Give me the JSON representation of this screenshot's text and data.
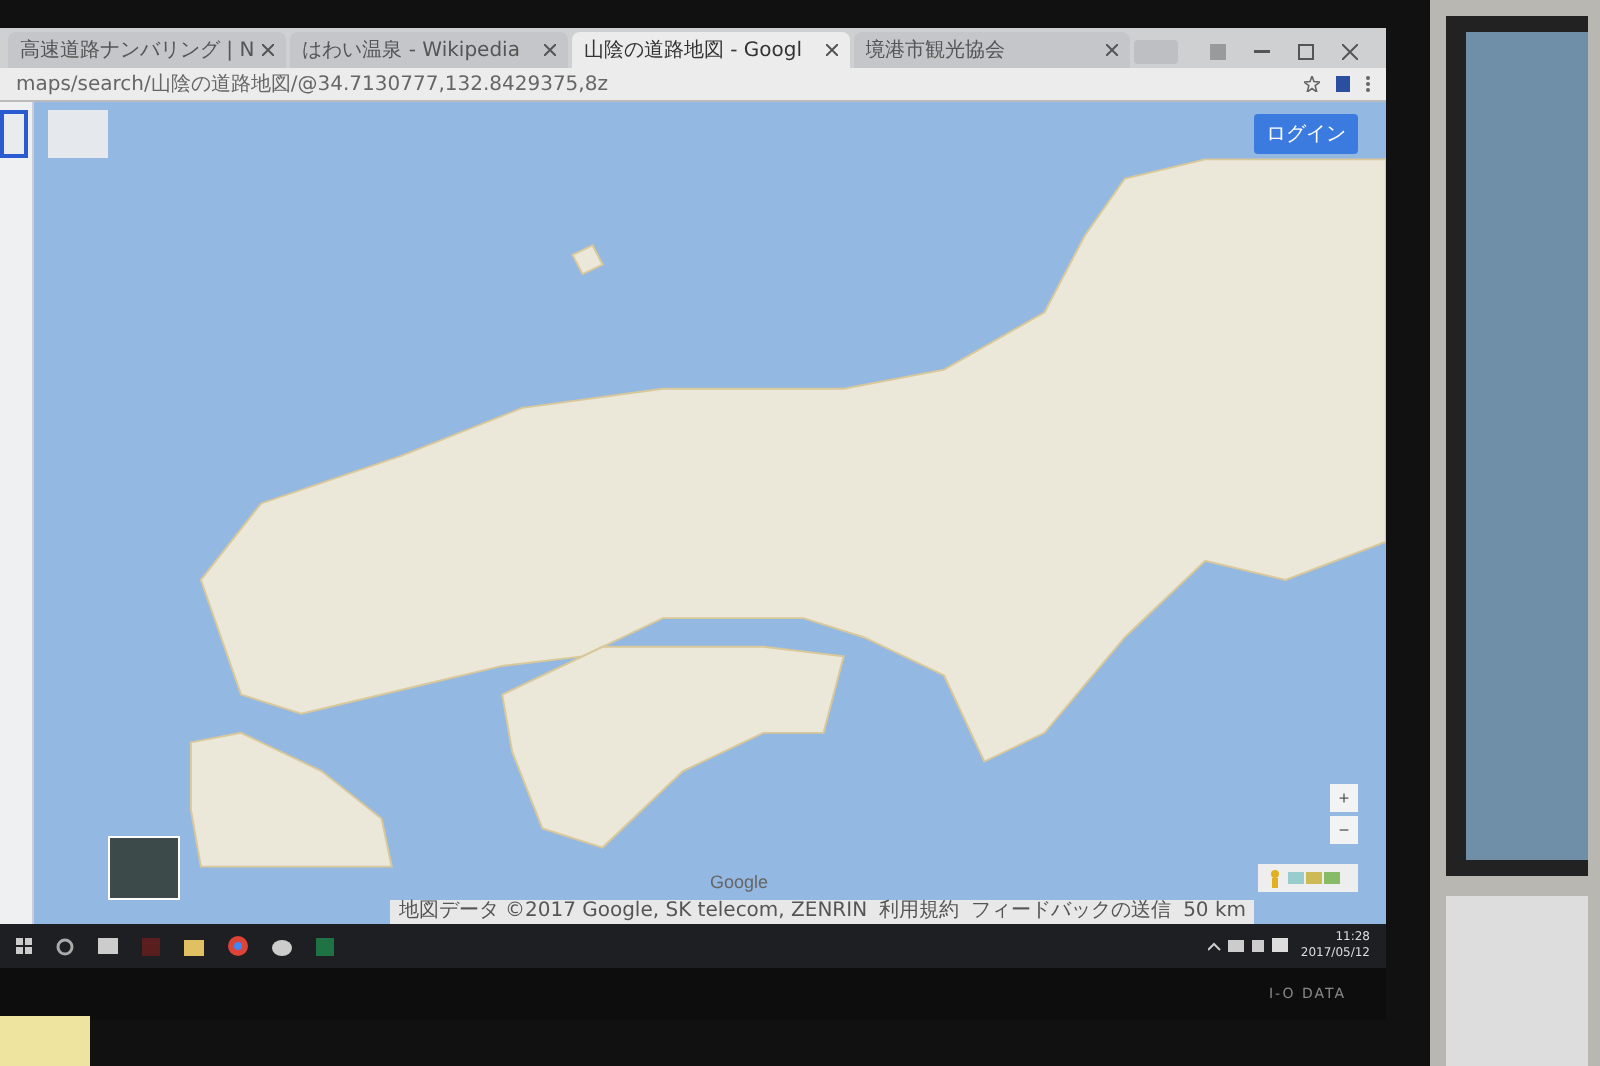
{
  "browser": {
    "tabs": [
      {
        "title": "高速道路ナンバリング | N",
        "selected": false
      },
      {
        "title": "はわい温泉 - Wikipedia",
        "selected": false
      },
      {
        "title": "山陰の道路地図 - Googl",
        "selected": true
      },
      {
        "title": "境港市観光協会",
        "selected": false
      }
    ],
    "address": "maps/search/山陰の道路地図/@34.7130777,132.8429375,8z"
  },
  "map": {
    "login_button": "ログイン",
    "zoom_in": "+",
    "zoom_out": "−",
    "logo": "Google",
    "attribution": [
      "地図データ ©2017 Google, SK telecom, ZENRIN",
      "利用規約",
      "フィードバックの送信",
      "50 km"
    ]
  },
  "taskbar": {
    "time": "11:28",
    "date": "2017/05/12"
  },
  "monitor": {
    "brand": "I-O DATA"
  }
}
